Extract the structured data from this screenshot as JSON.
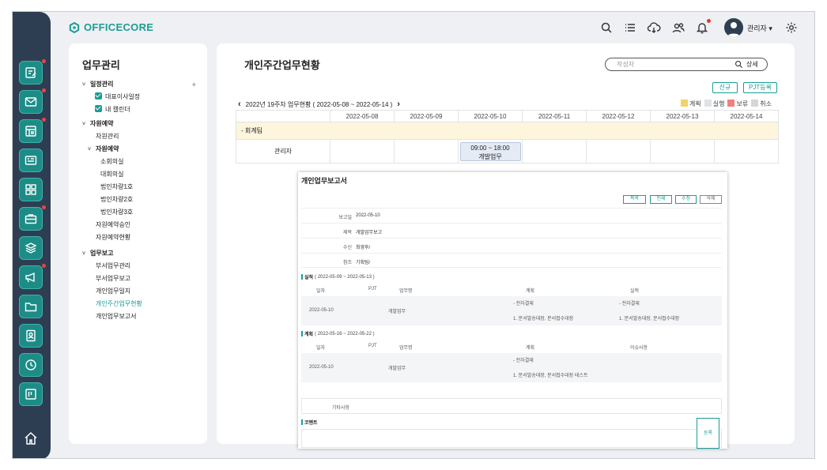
{
  "app": {
    "logo_text": "OFFICECORE"
  },
  "colors": {
    "accent": "#1c9c95",
    "rail": "#2e3e52",
    "plan": "#f2d36b",
    "done": "#dfe2e6",
    "hold": "#f08080",
    "cancel": "#d4d6d9"
  },
  "header": {
    "icons": [
      "search-icon",
      "list-icon",
      "cloud-download-icon",
      "users-icon",
      "bell-icon",
      "gear-icon"
    ],
    "user_name": "관리자 ▾"
  },
  "sidebar": {
    "title": "업무관리",
    "items": [
      {
        "label": "일정관리",
        "kind": "group"
      },
      {
        "label": "대표이사일정",
        "kind": "check"
      },
      {
        "label": "내 캘린더",
        "kind": "check"
      },
      {
        "label": "자원예약",
        "kind": "group"
      },
      {
        "label": "자원관리",
        "kind": "item"
      },
      {
        "label": "자원예약",
        "kind": "subgroup"
      },
      {
        "label": "소회의실",
        "kind": "subitem"
      },
      {
        "label": "대회의실",
        "kind": "subitem"
      },
      {
        "label": "법인차량1호",
        "kind": "subitem"
      },
      {
        "label": "법인차량2호",
        "kind": "subitem"
      },
      {
        "label": "법인차량3호",
        "kind": "subitem"
      },
      {
        "label": "자원예약승인",
        "kind": "item"
      },
      {
        "label": "자원예약현황",
        "kind": "item"
      },
      {
        "label": "업무보고",
        "kind": "group"
      },
      {
        "label": "부서업무관리",
        "kind": "item"
      },
      {
        "label": "부서업무보고",
        "kind": "item"
      },
      {
        "label": "개인업무일지",
        "kind": "item"
      },
      {
        "label": "개인주간업무현황",
        "kind": "active"
      },
      {
        "label": "개인업무보고서",
        "kind": "item"
      }
    ],
    "plus": "+"
  },
  "main": {
    "title": "개인주간업무현황",
    "search_placeholder": "작성자",
    "search_button": "상세",
    "btn_new": "신규",
    "btn_pjt": "PJT등록",
    "prev": "‹",
    "next": "›",
    "week_label": "2022년 19주차 업무현황 ( 2022-05-08 ~ 2022-05-14 )",
    "legend": [
      "계획",
      "실행",
      "보류",
      "취소"
    ],
    "dates": [
      "2022-05-08",
      "2022-05-09",
      "2022-05-10",
      "2022-05-11",
      "2022-05-12",
      "2022-05-13",
      "2022-05-14"
    ],
    "team": "- 회계팀",
    "person": "관리자",
    "event_time": "09:00 ~ 18:00",
    "event_title": "개발업무"
  },
  "report": {
    "title": "개인업무보고서",
    "buttons": [
      "목록",
      "인쇄",
      "수정",
      "삭제"
    ],
    "info": [
      {
        "label": "보고일",
        "value": "2022-05-10"
      },
      {
        "label": "제목",
        "value": "개발업무보고"
      },
      {
        "label": "수신",
        "value": "최영후/"
      },
      {
        "label": "참조",
        "value": "기획팀/"
      }
    ],
    "actual": {
      "title": "실적",
      "range": "( 2022-05-09 ~ 2022-05-13 )",
      "headers": [
        "일자",
        "PJT",
        "업무명",
        "계획",
        "실적"
      ],
      "date": "2022-05-10",
      "task": "개발업무",
      "plan_1": "- 전자결재",
      "plan_2": "1. 문서발송대장, 문서접수대장",
      "result_1": "- 전자결재",
      "result_2": "1. 문서발송대장, 문서접수대장"
    },
    "plan": {
      "title": "계획",
      "range": "( 2022-05-16 ~ 2022-05-22 )",
      "headers": [
        "일자",
        "PJT",
        "업무명",
        "계획",
        "이슈사항"
      ],
      "date": "2022-05-10",
      "task": "개발업무",
      "plan_1": "- 전자결재",
      "plan_2": "1. 문서발송대장, 문서접수대장 테스트"
    },
    "etc_label": "기타사항",
    "comment_title": "코멘트",
    "register": "등록"
  }
}
